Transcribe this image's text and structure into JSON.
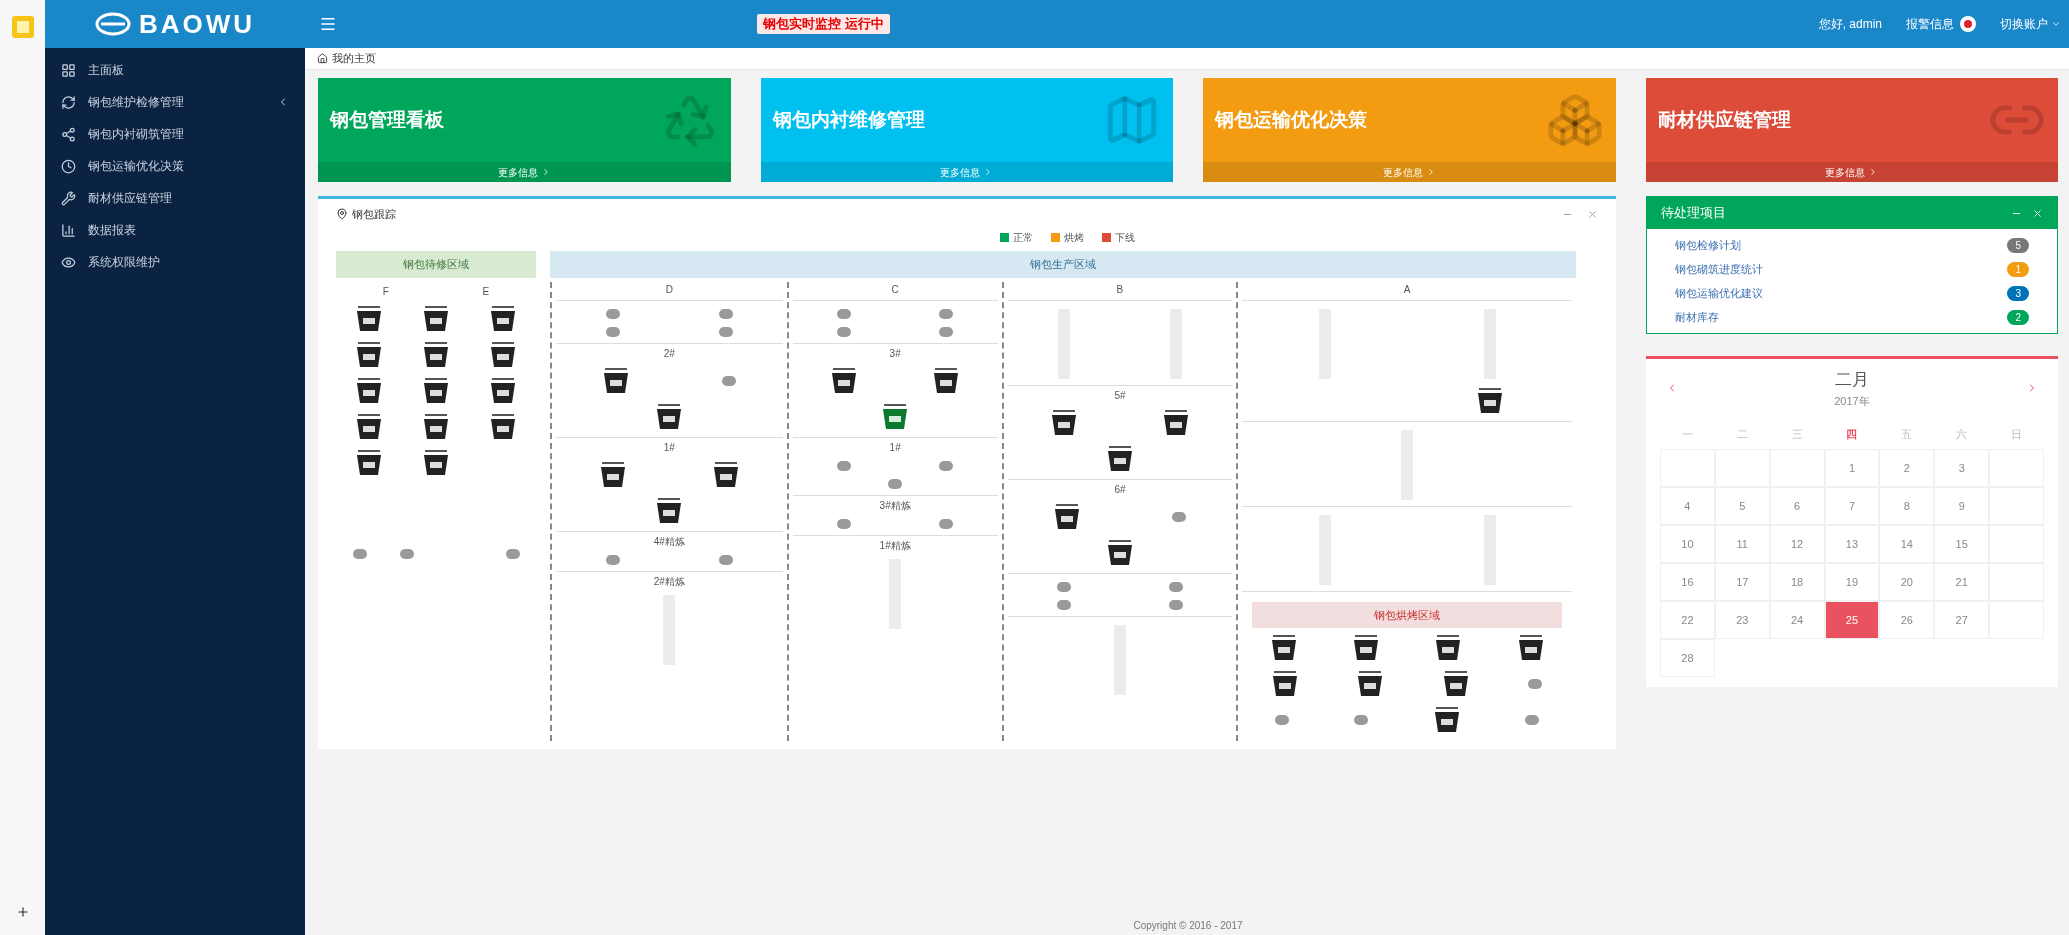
{
  "header": {
    "logo": "BAOWU",
    "notice": "钢包实时监控 运行中",
    "user": "您好, admin",
    "alerts": "报警信息",
    "account": "切换账户"
  },
  "sidebar": {
    "items": [
      {
        "label": "主面板",
        "submenu": false
      },
      {
        "label": "钢包维护检修管理",
        "submenu": true
      },
      {
        "label": "钢包内衬砌筑管理",
        "submenu": false
      },
      {
        "label": "钢包运输优化决策",
        "submenu": false
      },
      {
        "label": "耐材供应链管理",
        "submenu": false
      },
      {
        "label": "数据报表",
        "submenu": false
      },
      {
        "label": "系统权限维护",
        "submenu": false
      }
    ]
  },
  "breadcrumb": "我的主页",
  "cards": [
    {
      "title": "钢包管理看板",
      "more": "更多信息",
      "color": "#00a65a"
    },
    {
      "title": "钢包内衬维修管理",
      "more": "更多信息",
      "color": "#00c0ef"
    },
    {
      "title": "钢包运输优化决策",
      "more": "更多信息",
      "color": "#f39c12"
    },
    {
      "title": "耐材供应链管理",
      "more": "更多信息",
      "color": "#dd4b39"
    }
  ],
  "tracking": {
    "title": "钢包跟踪",
    "legend": [
      {
        "label": "正常",
        "color": "#00a65a"
      },
      {
        "label": "烘烤",
        "color": "#f39c12"
      },
      {
        "label": "下线",
        "color": "#dd4b39"
      }
    ],
    "waiting_zone": {
      "title": "钢包待修区域",
      "columns": [
        "F",
        "E"
      ],
      "sections": [
        {
          "rows": [
            [
              {
                "kind": "ladle",
                "color": "#222222"
              },
              {
                "kind": "ladle",
                "color": "#222222"
              },
              {
                "kind": "ladle",
                "color": "#222222"
              }
            ],
            [
              {
                "kind": "ladle",
                "color": "#222222"
              },
              {
                "kind": "ladle",
                "color": "#222222"
              },
              {
                "kind": "ladle",
                "color": "#222222"
              }
            ],
            [
              {
                "kind": "ladle",
                "color": "#222222"
              },
              {
                "kind": "ladle",
                "color": "#222222"
              },
              {
                "kind": "ladle",
                "color": "#222222"
              }
            ],
            [
              {
                "kind": "ladle",
                "color": "#222222"
              },
              {
                "kind": "ladle",
                "color": "#222222"
              },
              {
                "kind": "ladle",
                "color": "#222222"
              }
            ],
            [
              {
                "kind": "ladle",
                "color": "#222222"
              },
              {
                "kind": "ladle",
                "color": "#222222"
              },
              {
                "kind": "space"
              }
            ]
          ]
        },
        {
          "rows": [
            [
              {
                "kind": "empty"
              },
              {
                "kind": "empty"
              },
              {
                "kind": "space"
              },
              {
                "kind": "empty"
              }
            ]
          ]
        }
      ]
    },
    "production_zone": {
      "title": "钢包生产区域",
      "columns": [
        {
          "label": "D",
          "sections": [
            {
              "kind": "plain",
              "rows": [
                [
                  {
                    "kind": "empty"
                  },
                  {
                    "kind": "empty"
                  }
                ],
                [
                  {
                    "kind": "empty"
                  },
                  {
                    "kind": "empty"
                  }
                ]
              ]
            },
            {
              "kind": "plain",
              "label": "2#",
              "rows": [
                [
                  {
                    "kind": "ladle",
                    "color": "#222222"
                  },
                  {
                    "kind": "empty"
                  }
                ],
                [
                  {
                    "kind": "ladle",
                    "color": "#222222"
                  }
                ]
              ]
            },
            {
              "kind": "plain",
              "label": "1#",
              "rows": [
                [
                  {
                    "kind": "ladle",
                    "color": "#222222"
                  },
                  {
                    "kind": "ladle",
                    "color": "#222222"
                  }
                ],
                [
                  {
                    "kind": "ladle",
                    "color": "#222222"
                  }
                ]
              ]
            },
            {
              "kind": "plain",
              "label": "4#精炼",
              "rows": [
                [
                  {
                    "kind": "empty"
                  },
                  {
                    "kind": "empty"
                  }
                ]
              ]
            },
            {
              "kind": "plain",
              "label": "2#精炼",
              "rows": [
                [
                  {
                    "kind": "pipe"
                  }
                ]
              ]
            }
          ]
        },
        {
          "label": "C",
          "sections": [
            {
              "kind": "plain",
              "rows": [
                [
                  {
                    "kind": "empty"
                  },
                  {
                    "kind": "empty"
                  }
                ],
                [
                  {
                    "kind": "empty"
                  },
                  {
                    "kind": "empty"
                  }
                ]
              ]
            },
            {
              "kind": "plain",
              "label": "3#",
              "rows": [
                [
                  {
                    "kind": "ladle",
                    "color": "#222222"
                  },
                  {
                    "kind": "ladle",
                    "color": "#222222"
                  }
                ],
                [
                  {
                    "kind": "ladle",
                    "color": "#0b7a2e"
                  }
                ]
              ]
            },
            {
              "kind": "plain",
              "label": "1#",
              "rows": [
                [
                  {
                    "kind": "empty"
                  },
                  {
                    "kind": "empty"
                  }
                ],
                [
                  {
                    "kind": "empty"
                  }
                ]
              ]
            },
            {
              "kind": "plain",
              "label": "3#精炼",
              "rows": [
                [
                  {
                    "kind": "empty"
                  },
                  {
                    "kind": "empty"
                  }
                ]
              ]
            },
            {
              "kind": "plain",
              "label": "1#精炼",
              "rows": [
                [
                  {
                    "kind": "pipe"
                  }
                ]
              ]
            }
          ]
        },
        {
          "label": "B",
          "sections": [
            {
              "kind": "plain",
              "rows": [
                [
                  {
                    "kind": "pipe"
                  },
                  {
                    "kind": "pipe"
                  }
                ]
              ]
            },
            {
              "kind": "plain",
              "label": "5#",
              "rows": [
                [
                  {
                    "kind": "ladle",
                    "color": "#222222"
                  },
                  {
                    "kind": "ladle",
                    "color": "#222222"
                  }
                ],
                [
                  {
                    "kind": "ladle",
                    "color": "#222222"
                  }
                ]
              ]
            },
            {
              "kind": "plain",
              "label": "6#",
              "rows": [
                [
                  {
                    "kind": "ladle",
                    "color": "#222222"
                  },
                  {
                    "kind": "empty"
                  }
                ],
                [
                  {
                    "kind": "ladle",
                    "color": "#222222"
                  }
                ]
              ]
            },
            {
              "kind": "plain",
              "rows": [
                [
                  {
                    "kind": "empty"
                  },
                  {
                    "kind": "empty"
                  }
                ],
                [
                  {
                    "kind": "empty"
                  },
                  {
                    "kind": "empty"
                  }
                ]
              ]
            },
            {
              "kind": "plain",
              "rows": [
                [
                  {
                    "kind": "pipe"
                  }
                ]
              ]
            }
          ]
        },
        {
          "label": "A",
          "sections": [
            {
              "kind": "plain",
              "rows": [
                [
                  {
                    "kind": "pipe"
                  },
                  {
                    "kind": "pipe"
                  }
                ],
                [
                  {
                    "kind": "space"
                  },
                  {
                    "kind": "ladle",
                    "color": "#222222"
                  }
                ]
              ]
            },
            {
              "kind": "plain",
              "rows": [
                [
                  {
                    "kind": "pipe"
                  }
                ]
              ]
            },
            {
              "kind": "plain",
              "rows": [
                [
                  {
                    "kind": "pipe"
                  },
                  {
                    "kind": "pipe"
                  }
                ]
              ]
            },
            {
              "kind": "band",
              "label": "钢包烘烤区域",
              "rows": [
                [
                  {
                    "kind": "ladle",
                    "color": "#222222"
                  },
                  {
                    "kind": "ladle",
                    "color": "#222222"
                  },
                  {
                    "kind": "ladle",
                    "color": "#222222"
                  },
                  {
                    "kind": "ladle",
                    "color": "#222222"
                  }
                ],
                [
                  {
                    "kind": "ladle",
                    "color": "#222222"
                  },
                  {
                    "kind": "ladle",
                    "color": "#222222"
                  },
                  {
                    "kind": "ladle",
                    "color": "#222222"
                  },
                  {
                    "kind": "empty"
                  }
                ],
                [
                  {
                    "kind": "empty"
                  },
                  {
                    "kind": "empty"
                  },
                  {
                    "kind": "ladle",
                    "color": "#222222"
                  },
                  {
                    "kind": "empty"
                  }
                ]
              ]
            }
          ]
        }
      ]
    }
  },
  "tasks": {
    "title": "待处理项目",
    "items": [
      {
        "label": "钢包检修计划",
        "count": "5",
        "color": "#777777"
      },
      {
        "label": "钢包砌筑进度统计",
        "count": "1",
        "color": "#f39c12"
      },
      {
        "label": "钢包运输优化建议",
        "count": "3",
        "color": "#0073b7"
      },
      {
        "label": "耐材库存",
        "count": "2",
        "color": "#00a65a"
      }
    ]
  },
  "calendar": {
    "month": "二月",
    "year": "2017年",
    "weekdays": [
      {
        "label": "一",
        "selected": false
      },
      {
        "label": "二",
        "selected": false
      },
      {
        "label": "三",
        "selected": false
      },
      {
        "label": "四",
        "selected": true
      },
      {
        "label": "五",
        "selected": false
      },
      {
        "label": "六",
        "selected": false
      },
      {
        "label": "日",
        "selected": false
      }
    ],
    "weeks": [
      [
        {
          "kind": "blank"
        },
        {
          "kind": "blank"
        },
        {
          "kind": "blank"
        },
        {
          "kind": "day",
          "day": "1",
          "selected": false
        },
        {
          "kind": "day",
          "day": "2",
          "selected": false
        },
        {
          "kind": "day",
          "day": "3",
          "selected": false
        },
        {
          "kind": "blank"
        }
      ],
      [
        {
          "kind": "day",
          "day": "4",
          "selected": false
        },
        {
          "kind": "day",
          "day": "5",
          "selected": false
        },
        {
          "kind": "day",
          "day": "6",
          "selected": false
        },
        {
          "kind": "day",
          "day": "7",
          "selected": false
        },
        {
          "kind": "day",
          "day": "8",
          "selected": false
        },
        {
          "kind": "day",
          "day": "9",
          "selected": false
        },
        {
          "kind": "blank"
        }
      ],
      [
        {
          "kind": "day",
          "day": "10",
          "selected": false
        },
        {
          "kind": "day",
          "day": "11",
          "selected": false
        },
        {
          "kind": "day",
          "day": "12",
          "selected": false
        },
        {
          "kind": "day",
          "day": "13",
          "selected": false
        },
        {
          "kind": "day",
          "day": "14",
          "selected": false
        },
        {
          "kind": "day",
          "day": "15",
          "selected": false
        },
        {
          "kind": "blank"
        }
      ],
      [
        {
          "kind": "day",
          "day": "16",
          "selected": false
        },
        {
          "kind": "day",
          "day": "17",
          "selected": false
        },
        {
          "kind": "day",
          "day": "18",
          "selected": false
        },
        {
          "kind": "day",
          "day": "19",
          "selected": false
        },
        {
          "kind": "day",
          "day": "20",
          "selected": false
        },
        {
          "kind": "day",
          "day": "21",
          "selected": false
        },
        {
          "kind": "blank"
        }
      ],
      [
        {
          "kind": "day",
          "day": "22",
          "selected": false
        },
        {
          "kind": "day",
          "day": "23",
          "selected": false
        },
        {
          "kind": "day",
          "day": "24",
          "selected": false
        },
        {
          "kind": "day",
          "day": "25",
          "selected": true
        },
        {
          "kind": "day",
          "day": "26",
          "selected": false
        },
        {
          "kind": "day",
          "day": "27",
          "selected": false
        },
        {
          "kind": "blank"
        }
      ],
      [
        {
          "kind": "day",
          "day": "28",
          "selected": false
        }
      ]
    ]
  },
  "footer": "Copyright © 2016 - 2017"
}
